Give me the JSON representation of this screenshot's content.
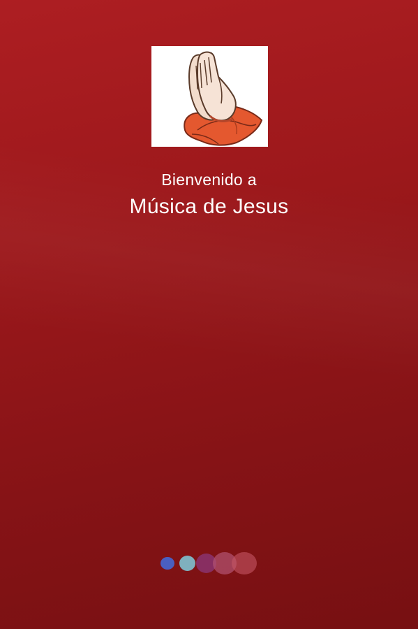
{
  "splash": {
    "welcome_text": "Bienvenido a",
    "app_name": "Música de Jesus"
  },
  "logo": {
    "icon": "praying-hands-icon"
  },
  "loader": {
    "dots": [
      "#4a5fc0",
      "#7fb0be",
      "#8a346e",
      "#b25270",
      "#c45664"
    ]
  },
  "colors": {
    "background_top": "#ad1e22",
    "background_bottom": "#771012",
    "text": "#ffffff"
  }
}
